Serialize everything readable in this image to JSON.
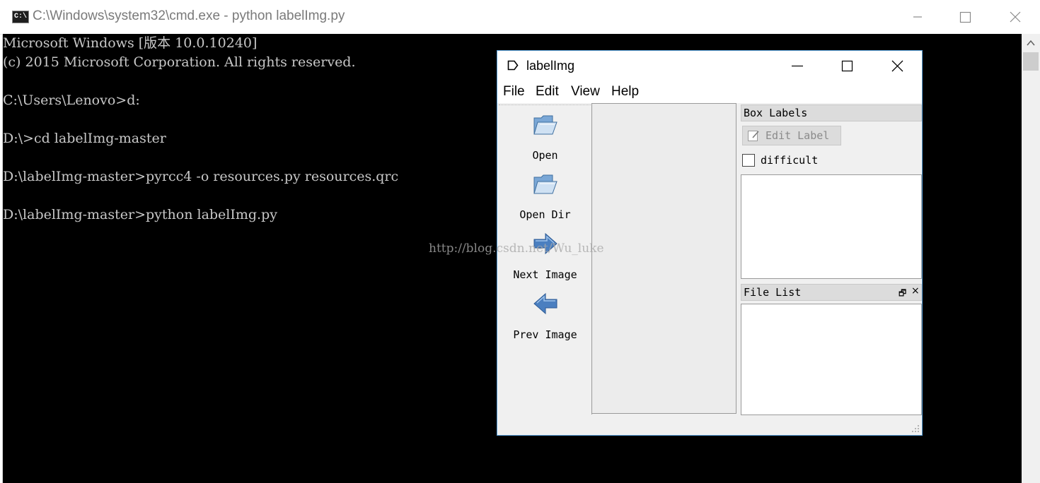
{
  "cmd": {
    "title": "C:\\Windows\\system32\\cmd.exe - python  labelImg.py",
    "icon_text": "C:\\",
    "lines": [
      "Microsoft Windows [版本 10.0.10240]",
      "(c) 2015 Microsoft Corporation. All rights reserved.",
      "",
      "C:\\Users\\Lenovo>d:",
      "",
      "D:\\>cd labelImg-master",
      "",
      "D:\\labelImg-master>pyrcc4 -o resources.py resources.qrc",
      "",
      "D:\\labelImg-master>python labelImg.py"
    ],
    "colors": {
      "background": "#000000",
      "text": "#c8c8c8"
    }
  },
  "labelimg": {
    "title": "labelImg",
    "menu": [
      "File",
      "Edit",
      "View",
      "Help"
    ],
    "tools": [
      {
        "label": "Open",
        "icon": "open-folder-icon"
      },
      {
        "label": "Open Dir",
        "icon": "open-folder-icon"
      },
      {
        "label": "Next Image",
        "icon": "arrow-right-icon"
      },
      {
        "label": "Prev Image",
        "icon": "arrow-left-icon"
      }
    ],
    "toolbar_more": "»",
    "box_labels": {
      "title": "Box Labels",
      "edit_label_button": "Edit Label",
      "difficult_label": "difficult",
      "difficult_checked": false
    },
    "file_list": {
      "title": "File List",
      "float_control": "🗗",
      "close_control": "×"
    },
    "colors": {
      "border": "#5aa0d8",
      "arrow": "#4a7fc0"
    }
  },
  "watermark": "http://blog.csdn.net/Wu_luke"
}
